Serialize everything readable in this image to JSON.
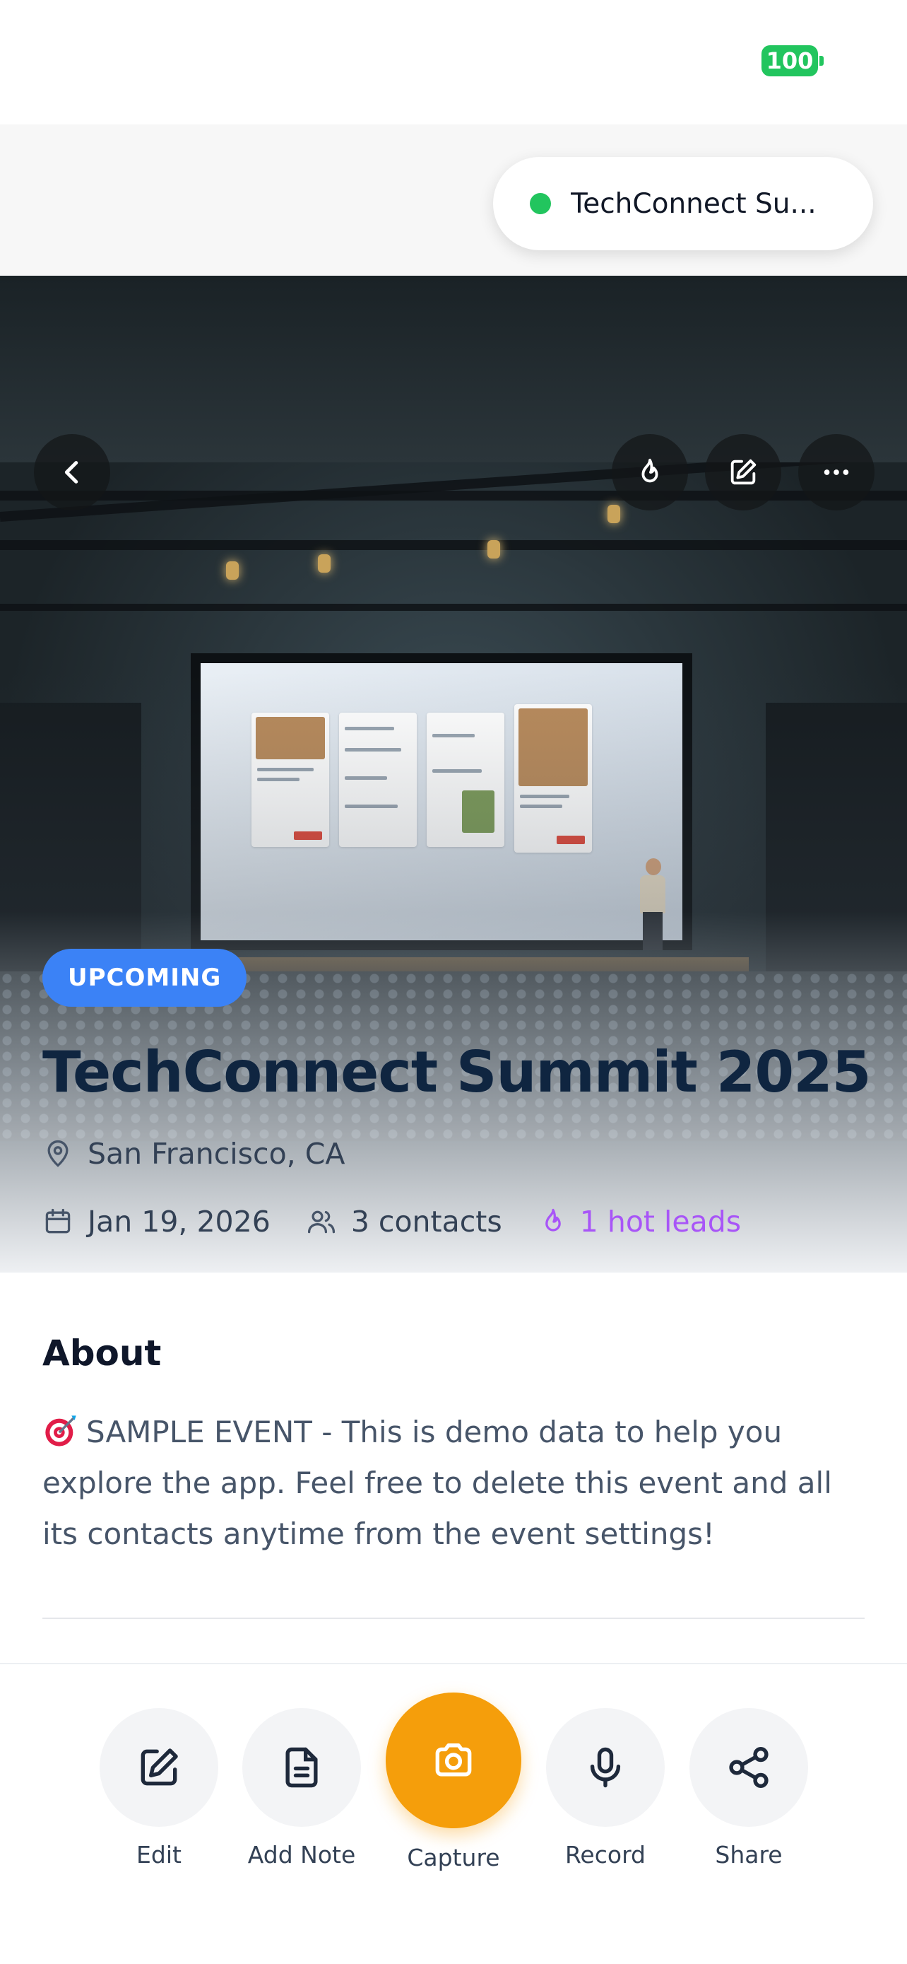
{
  "status_bar": {
    "battery": "100"
  },
  "notification": {
    "event_name": "TechConnect Su..."
  },
  "hero": {
    "badge": "UPCOMING"
  },
  "event": {
    "title": "TechConnect Summit 2025",
    "location": "San Francisco, CA",
    "date": "Jan 19, 2026",
    "contacts": "3 contacts",
    "hot_leads": "1 hot leads"
  },
  "about": {
    "heading": "About",
    "body": "SAMPLE EVENT - This is demo data to help you explore the app. Feel free to delete this event and all its contacts anytime from the event settings!"
  },
  "toolbar": {
    "edit": "Edit",
    "add_note": "Add Note",
    "capture": "Capture",
    "record": "Record",
    "share": "Share"
  },
  "colors": {
    "accent_orange": "#f59e0b",
    "badge_blue": "#3b82f6",
    "hot_purple": "#a855f7",
    "status_green": "#22c55e"
  }
}
